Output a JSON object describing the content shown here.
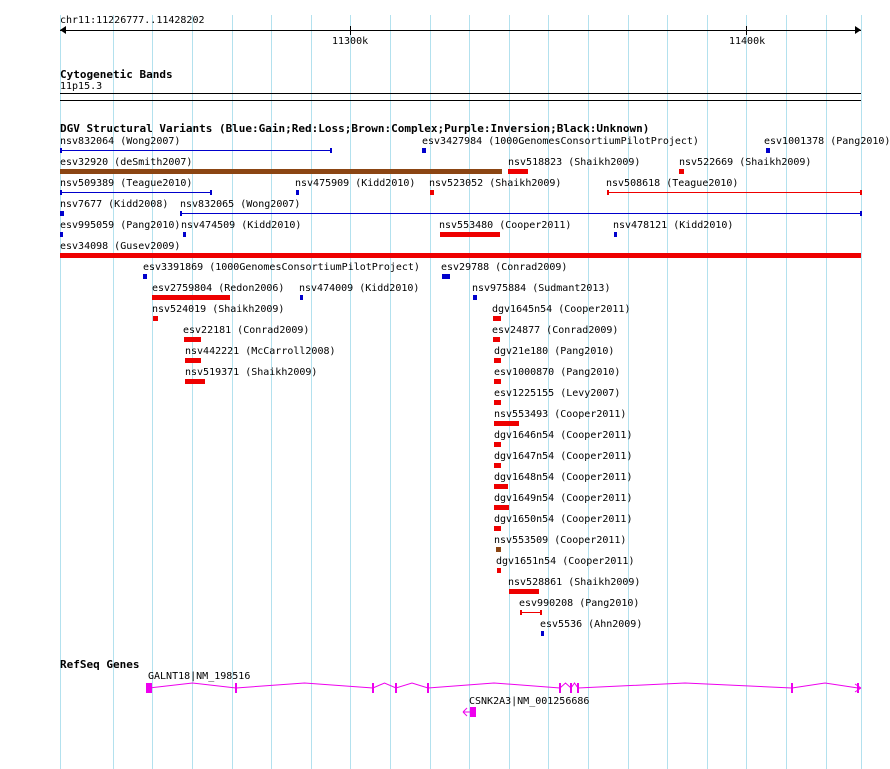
{
  "ruler": {
    "location": "chr11:11226777..11428202",
    "ticks": [
      "11300k",
      "11400k"
    ]
  },
  "cytobands": {
    "title": "Cytogenetic Bands",
    "band": "11p15.3"
  },
  "dgv": {
    "title": "DGV Structural Variants (Blue:Gain;Red:Loss;Brown:Complex;Purple:Inversion;Black:Unknown)",
    "colors": {
      "gain": "#0000cc",
      "loss": "#ee0000",
      "complex": "#8b4513",
      "inversion": "#800080",
      "unknown": "#000000"
    },
    "features": [
      {
        "label": "nsv832064 (Wong2007)",
        "type": "gain"
      },
      {
        "label": "esv3427984 (1000GenomesConsortiumPilotProject)",
        "type": "gain"
      },
      {
        "label": "esv1001378 (Pang2010)",
        "type": "gain"
      },
      {
        "label": "esv32920 (deSmith2007)",
        "type": "complex"
      },
      {
        "label": "nsv518823 (Shaikh2009)",
        "type": "loss"
      },
      {
        "label": "nsv522669 (Shaikh2009)",
        "type": "loss"
      },
      {
        "label": "nsv509389 (Teague2010)",
        "type": "gain"
      },
      {
        "label": "nsv475909 (Kidd2010)",
        "type": "gain"
      },
      {
        "label": "nsv523052 (Shaikh2009)",
        "type": "loss"
      },
      {
        "label": "nsv508618 (Teague2010)",
        "type": "loss"
      },
      {
        "label": "nsv7677 (Kidd2008)",
        "type": "gain"
      },
      {
        "label": "nsv832065 (Wong2007)",
        "type": "gain"
      },
      {
        "label": "esv995059 (Pang2010)",
        "type": "gain"
      },
      {
        "label": "nsv474509 (Kidd2010)",
        "type": "gain"
      },
      {
        "label": "nsv553480 (Cooper2011)",
        "type": "loss"
      },
      {
        "label": "nsv478121 (Kidd2010)",
        "type": "gain"
      },
      {
        "label": "esv34098 (Gusev2009)",
        "type": "loss"
      },
      {
        "label": "esv3391869 (1000GenomesConsortiumPilotProject)",
        "type": "gain"
      },
      {
        "label": "esv29788 (Conrad2009)",
        "type": "gain"
      },
      {
        "label": "esv2759804 (Redon2006)",
        "type": "loss"
      },
      {
        "label": "nsv474009 (Kidd2010)",
        "type": "gain"
      },
      {
        "label": "nsv975884 (Sudmant2013)",
        "type": "gain"
      },
      {
        "label": "nsv524019 (Shaikh2009)",
        "type": "loss"
      },
      {
        "label": "dgv1645n54 (Cooper2011)",
        "type": "loss"
      },
      {
        "label": "esv22181 (Conrad2009)",
        "type": "loss"
      },
      {
        "label": "esv24877 (Conrad2009)",
        "type": "loss"
      },
      {
        "label": "nsv442221 (McCarroll2008)",
        "type": "loss"
      },
      {
        "label": "dgv21e180 (Pang2010)",
        "type": "loss"
      },
      {
        "label": "nsv519371 (Shaikh2009)",
        "type": "loss"
      },
      {
        "label": "esv1000870 (Pang2010)",
        "type": "loss"
      },
      {
        "label": "esv1225155 (Levy2007)",
        "type": "loss"
      },
      {
        "label": "nsv553493 (Cooper2011)",
        "type": "loss"
      },
      {
        "label": "dgv1646n54 (Cooper2011)",
        "type": "loss"
      },
      {
        "label": "dgv1647n54 (Cooper2011)",
        "type": "loss"
      },
      {
        "label": "dgv1648n54 (Cooper2011)",
        "type": "loss"
      },
      {
        "label": "dgv1649n54 (Cooper2011)",
        "type": "loss"
      },
      {
        "label": "dgv1650n54 (Cooper2011)",
        "type": "loss"
      },
      {
        "label": "nsv553509 (Cooper2011)",
        "type": "complex"
      },
      {
        "label": "dgv1651n54 (Cooper2011)",
        "type": "loss"
      },
      {
        "label": "nsv528861 (Shaikh2009)",
        "type": "loss"
      },
      {
        "label": "esv990208 (Pang2010)",
        "type": "loss"
      },
      {
        "label": "esv5536 (Ahn2009)",
        "type": "gain"
      }
    ]
  },
  "refseq": {
    "title": "RefSeq Genes",
    "colors": {
      "gene": "#ee00ee"
    },
    "genes": [
      {
        "label": "GALNT18|NM_198516"
      },
      {
        "label": "CSNK2A3|NM_001256686"
      }
    ]
  }
}
